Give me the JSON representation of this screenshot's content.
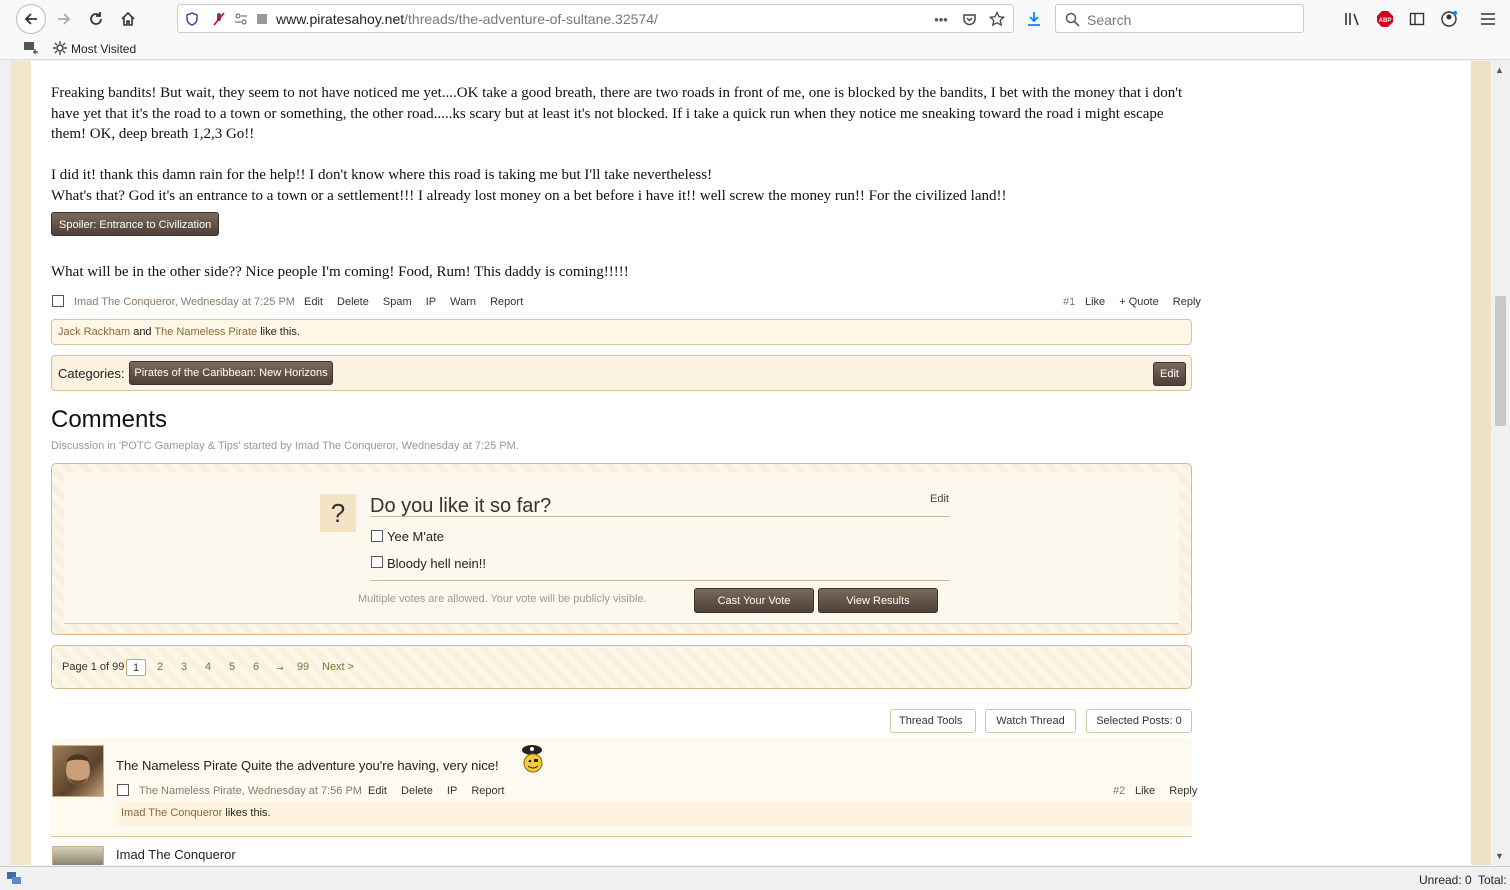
{
  "browser": {
    "url_domain": "www.piratesahoy.net",
    "url_path": "/threads/the-adventure-of-sultane.32574/",
    "search_placeholder": "Search",
    "bookmark": "Most Visited",
    "status_unread": "Unread: 0",
    "status_total": "Total:"
  },
  "post1": {
    "para1": "Freaking bandits! But wait, they seem to not have noticed me yet....OK take a good breath, there are two roads in front of me, one is blocked by the bandits, I bet with the money that i don't have yet that it's the road to a town or something, the other road.....ks scary but at least it's not blocked. If i take a quick run when they notice me sneaking toward the road i might escape them! OK, deep breath 1,2,3 Go!!",
    "para2a": "I did it! thank this damn rain for the help!! I don't know where this road is taking me but I'll take nevertheless!",
    "para2b": "What's that? God it's an entrance to a town or a settlement!!! I already lost money on a bet before i have it!! well screw the money run!! For the civilized land!!",
    "spoiler_label": "Spoiler: Entrance to Civilization",
    "para3": "What will be in the other side?? Nice people I'm coming! Food, Rum! This daddy is coming!!!!!",
    "author": "Imad The Conqueror",
    "time": ", Wednesday at 7:25 PM",
    "actions": [
      "Edit",
      "Delete",
      "Spam",
      "IP",
      "Warn",
      "Report"
    ],
    "number": "#1",
    "right_actions": [
      "Like",
      "+ Quote",
      "Reply"
    ],
    "likes_user1": "Jack Rackham",
    "likes_and": " and ",
    "likes_user2": "The Nameless Pirate",
    "likes_tail": " like this."
  },
  "categories": {
    "label": "Categories:",
    "tag": "Pirates of the Caribbean: New Horizons",
    "edit": "Edit"
  },
  "comments": {
    "title": "Comments",
    "discussion": "Discussion in 'POTC Gameplay & Tips' started by Imad The Conqueror, Wednesday at 7:25 PM."
  },
  "poll": {
    "qmark": "?",
    "question": "Do you like it so far?",
    "edit": "Edit",
    "options": [
      "Yee M'ate",
      "Bloody hell nein!!"
    ],
    "note": "Multiple votes are allowed. Your vote will be publicly visible.",
    "cast": "Cast Your Vote",
    "view": "View Results"
  },
  "pager": {
    "label": "Page 1 of 99",
    "pages": [
      "1",
      "2",
      "3",
      "4",
      "5",
      "6"
    ],
    "arrow": "→",
    "last": "99",
    "next": "Next >"
  },
  "tools": {
    "thread_tools": "Thread Tools",
    "watch": "Watch Thread",
    "selected": "Selected Posts: 0"
  },
  "post2": {
    "author": "The Nameless Pirate",
    "message": "Quite the adventure you're having, very nice!",
    "meta_author": "The Nameless Pirate",
    "time": ", Wednesday at 7:56 PM",
    "actions": [
      "Edit",
      "Delete",
      "IP",
      "Report"
    ],
    "number": "#2",
    "right_actions": [
      "Like",
      "Reply"
    ],
    "likes_user": "Imad The Conqueror",
    "likes_tail": " likes this."
  },
  "post3": {
    "author": "Imad The Conqueror"
  }
}
